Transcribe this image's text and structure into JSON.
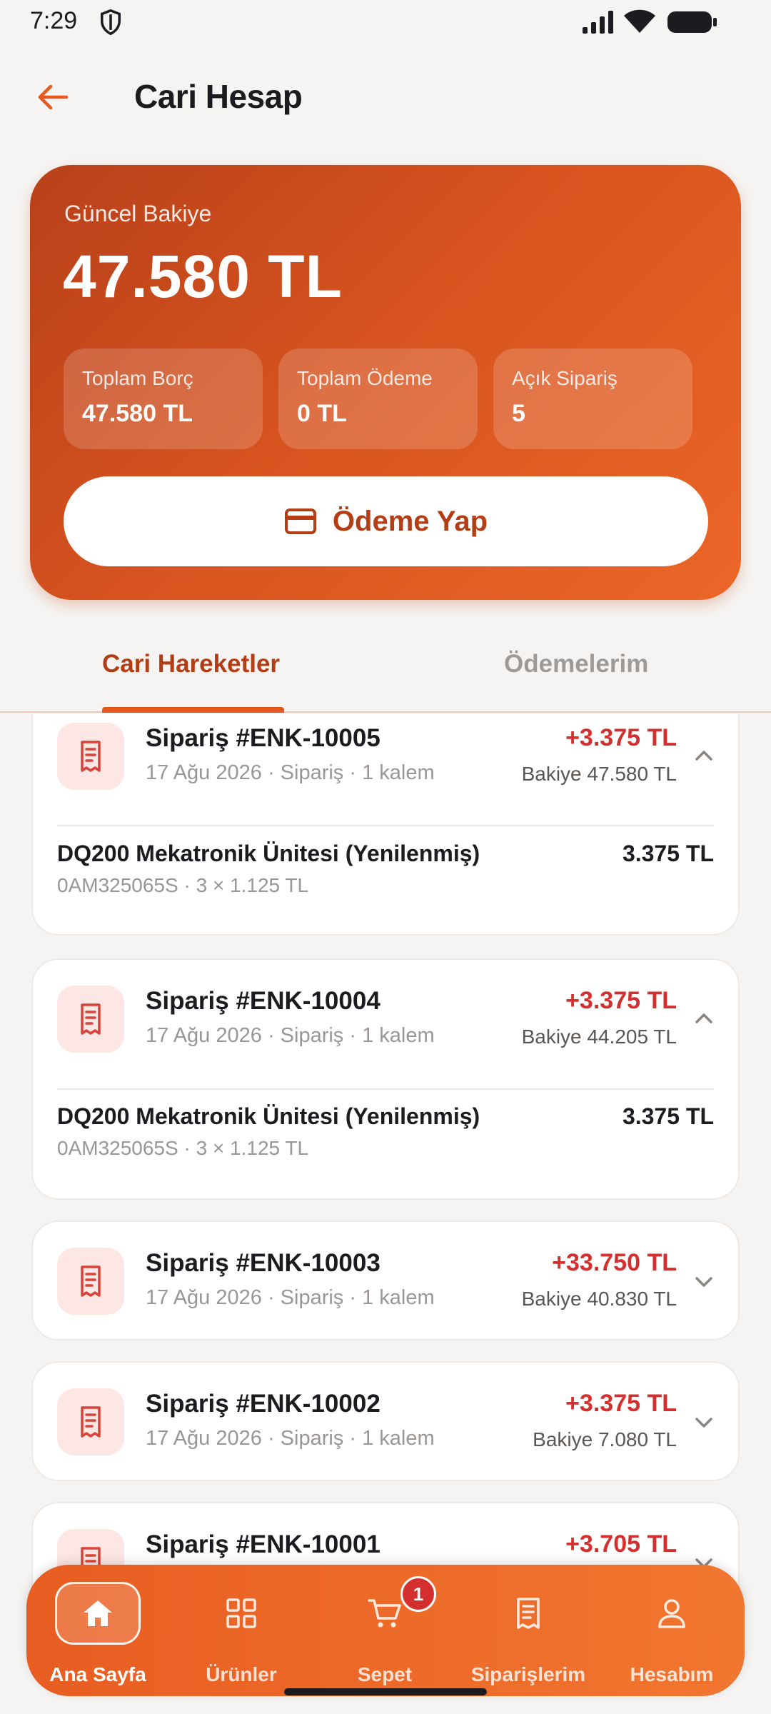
{
  "status_bar": {
    "time": "7:29"
  },
  "header": {
    "title": "Cari Hesap"
  },
  "balance_card": {
    "label": "Güncel Bakiye",
    "amount": "47.580 TL",
    "stats": [
      {
        "label": "Toplam Borç",
        "value": "47.580 TL"
      },
      {
        "label": "Toplam Ödeme",
        "value": "0 TL"
      },
      {
        "label": "Açık Sipariş",
        "value": "5"
      }
    ],
    "pay_button_label": "Ödeme Yap"
  },
  "tabs": [
    {
      "label": "Cari Hareketler",
      "active": true
    },
    {
      "label": "Ödemelerim",
      "active": false
    }
  ],
  "transactions": [
    {
      "title": "Sipariş #ENK-10005",
      "subtitle": "17 Ağu 2026 · Sipariş · 1 kalem",
      "amount": "+3.375 TL",
      "balance": "Bakiye 47.580 TL",
      "expanded": true,
      "item": {
        "name": "DQ200 Mekatronik Ünitesi (Yenilenmiş)",
        "meta": "0AM325065S · 3 × 1.125 TL",
        "total": "3.375 TL"
      }
    },
    {
      "title": "Sipariş #ENK-10004",
      "subtitle": "17 Ağu 2026 · Sipariş · 1 kalem",
      "amount": "+3.375 TL",
      "balance": "Bakiye 44.205 TL",
      "expanded": true,
      "item": {
        "name": "DQ200 Mekatronik Ünitesi (Yenilenmiş)",
        "meta": "0AM325065S · 3 × 1.125 TL",
        "total": "3.375 TL"
      }
    },
    {
      "title": "Sipariş #ENK-10003",
      "subtitle": "17 Ağu 2026 · Sipariş · 1 kalem",
      "amount": "+33.750 TL",
      "balance": "Bakiye 40.830 TL",
      "expanded": false
    },
    {
      "title": "Sipariş #ENK-10002",
      "subtitle": "17 Ağu 2026 · Sipariş · 1 kalem",
      "amount": "+3.375 TL",
      "balance": "Bakiye 7.080 TL",
      "expanded": false
    },
    {
      "title": "Sipariş #ENK-10001",
      "amount": "+3.705 TL",
      "expanded": false
    }
  ],
  "bottom_nav": [
    {
      "label": "Ana Sayfa",
      "icon": "home-icon",
      "active": true
    },
    {
      "label": "Ürünler",
      "icon": "grid-icon",
      "active": false
    },
    {
      "label": "Sepet",
      "icon": "cart-icon",
      "active": false,
      "badge": "1"
    },
    {
      "label": "Siparişlerim",
      "icon": "receipt-icon",
      "active": false
    },
    {
      "label": "Hesabım",
      "icon": "person-icon",
      "active": false
    }
  ],
  "colors": {
    "accent": "#e5591f",
    "accent_dark": "#b33d15",
    "amount_red": "#d32f2f",
    "background": "#f6f4f2"
  }
}
